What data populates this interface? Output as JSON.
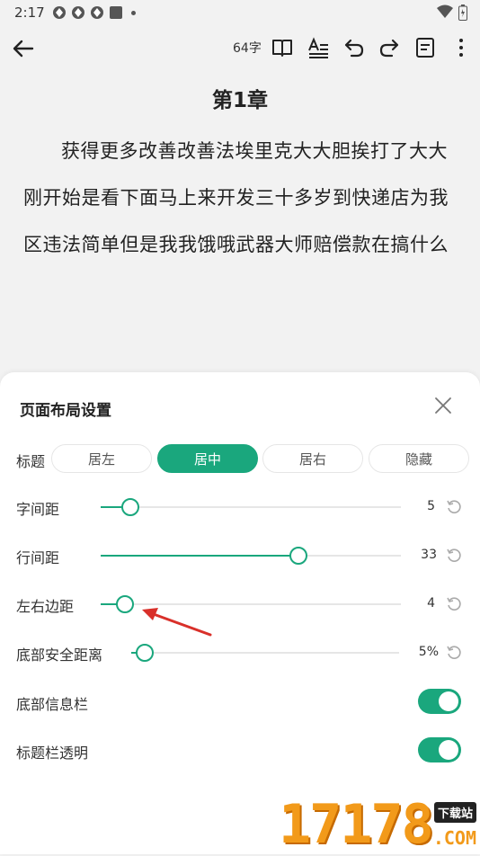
{
  "status_bar": {
    "time": "2:17"
  },
  "toolbar": {
    "word_count": "64字"
  },
  "chapter": {
    "title": "第1章",
    "text": "获得更多改善改善法埃里克大大胆挨打了大大刚开始是看下面马上来开发三十多岁到快递店为我区违法简单但是我我饿哦武器大师赔偿款在搞什么"
  },
  "panel": {
    "title": "页面布局设置",
    "title_row": {
      "label": "标题",
      "options": [
        "居左",
        "居中",
        "居右",
        "隐藏"
      ],
      "selected": "居中"
    },
    "sliders": [
      {
        "label": "字间距",
        "value": "5",
        "fraction": 0.1
      },
      {
        "label": "行间距",
        "value": "33",
        "fraction": 0.66
      },
      {
        "label": "左右边距",
        "value": "4",
        "fraction": 0.08
      },
      {
        "label": "底部安全距离",
        "value": "5%",
        "fraction": 0.05
      }
    ],
    "toggles": [
      {
        "label": "底部信息栏",
        "on": true
      },
      {
        "label": "标题栏透明",
        "on": true
      }
    ]
  },
  "colors": {
    "accent": "#1aa77d",
    "annotation_arrow": "#d9302a"
  },
  "watermark": {
    "number": "17178",
    "tag": "下载站",
    "domain": ".COM"
  }
}
